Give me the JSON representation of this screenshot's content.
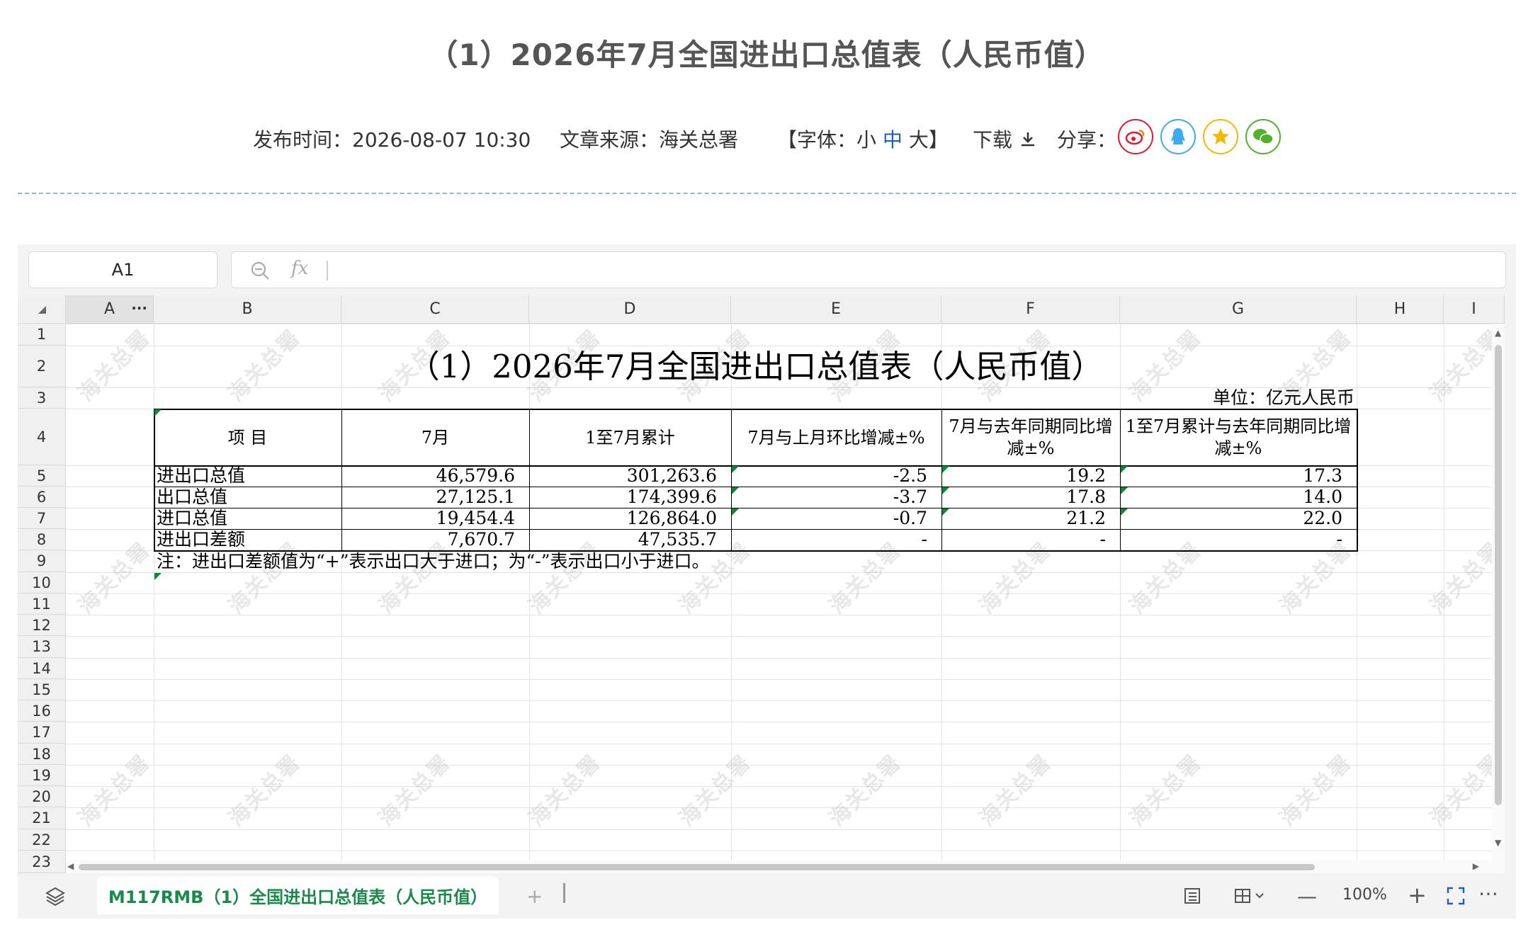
{
  "article": {
    "title": "（1）2026年7月全国进出口总值表（人民币值）",
    "publish": "发布时间：2026-08-07 10:30",
    "source": "文章来源：海关总署",
    "font_open": "【字体：",
    "font_small": "小",
    "font_medium": "中",
    "font_large": "大",
    "font_close": "】",
    "download": "下载",
    "share": "分享："
  },
  "share_icons": [
    "weibo-icon",
    "qq-icon",
    "qzone-star-icon",
    "wechat-icon"
  ],
  "colors": {
    "accent": "#1a8a4a",
    "weibo": "#e6162d",
    "qq": "#3eaaf0",
    "qzone": "#f5b800",
    "wechat": "#51b12a"
  },
  "sheet": {
    "name_box": "A1",
    "fx_label": "fx",
    "columns": [
      "A",
      "B",
      "C",
      "D",
      "E",
      "F",
      "G",
      "H",
      "I"
    ],
    "rows": [
      "1",
      "2",
      "3",
      "4",
      "5",
      "6",
      "7",
      "8",
      "9",
      "10",
      "11",
      "12",
      "13",
      "14",
      "15",
      "16",
      "17",
      "18",
      "19",
      "20",
      "21",
      "22",
      "23"
    ],
    "table_title": "（1）2026年7月全国进出口总值表（人民币值）",
    "unit": "单位：亿元人民币",
    "headers": [
      "项    目",
      "7月",
      "1至7月累计",
      "7月与上月环比增减±%",
      "7月与去年同期同比增减±%",
      "1至7月累计与去年同期同比增减±%"
    ],
    "data_rows": [
      [
        "进出口总值",
        "46,579.6",
        "301,263.6",
        "-2.5",
        "19.2",
        "17.3"
      ],
      [
        "出口总值",
        "27,125.1",
        "174,399.6",
        "-3.7",
        "17.8",
        "14.0"
      ],
      [
        "进口总值",
        "19,454.4",
        "126,864.0",
        "-0.7",
        "21.2",
        "22.0"
      ],
      [
        "进出口差额",
        "7,670.7",
        "47,535.7",
        "-",
        "-",
        "-"
      ]
    ],
    "note": "注：进出口差额值为“+”表示出口大于进口；为“-”表示出口小于进口。",
    "watermark": "海关总署",
    "tab_label": "M117RMB（1）全国进出口总值表（人民币值）",
    "zoom": "100%"
  }
}
